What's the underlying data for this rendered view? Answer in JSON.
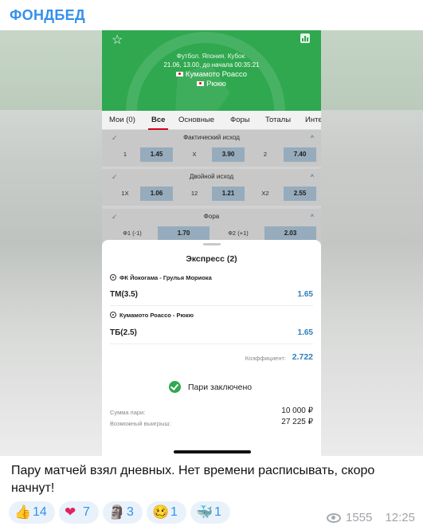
{
  "post": {
    "channel_name": "ФОНДБЕД",
    "caption": "Пару матчей взял дневных. Нет времени расписывать, скоро начнут!",
    "views": "1555",
    "time": "12:25"
  },
  "match": {
    "league": "Футбол. Япония. Кубок.",
    "datetime": "21.06, 13.00,  до начала 00:35:21",
    "team1": "Кумамото Роассо",
    "team2": "Рюкю",
    "icons": [
      "star-icon",
      "stats-icon",
      "flag-japan-icon"
    ],
    "header_color": "#2fa84f"
  },
  "tabs": [
    "Мои (0)",
    "Все",
    "Основные",
    "Форы",
    "Тоталы",
    "Инте"
  ],
  "active_tab": "Все",
  "markets": [
    {
      "title": "Фактический исход",
      "odds": [
        {
          "label": "1",
          "value": "1.45"
        },
        {
          "label": "X",
          "value": "3.90"
        },
        {
          "label": "2",
          "value": "7.40"
        }
      ]
    },
    {
      "title": "Двойной исход",
      "odds": [
        {
          "label": "1X",
          "value": "1.06"
        },
        {
          "label": "12",
          "value": "1.21"
        },
        {
          "label": "X2",
          "value": "2.55"
        }
      ]
    },
    {
      "title": "Фора",
      "odds": [
        {
          "label": "Ф1 (-1)",
          "value": "1.70"
        },
        {
          "label": "Ф2 (+1)",
          "value": "2.03"
        }
      ]
    }
  ],
  "express": {
    "title": "Экспресс (2)",
    "bets": [
      {
        "event": "ФК Йокогама - Грулья Мориока",
        "type": "ТМ(3.5)",
        "odd": "1.65"
      },
      {
        "event": "Кумамото Роассо - Рюкю",
        "type": "ТБ(2.5)",
        "odd": "1.65"
      }
    ],
    "coefficient_label": "Коэффициент:",
    "coefficient_value": "2.722",
    "status": "Пари заключено",
    "sum_label": "Сумма пари:",
    "sum_value": "10 000 ₽",
    "win_label": "Возможный выигрыш:",
    "win_value": "27 225 ₽",
    "accent_color": "#2a7fc0"
  },
  "reactions": [
    {
      "emoji": "👍",
      "name": "thumbs-up-icon",
      "count": "14"
    },
    {
      "emoji": "❤",
      "name": "heart-icon",
      "count": "7"
    },
    {
      "emoji": "🗿",
      "name": "moai-icon",
      "count": "3"
    },
    {
      "emoji": "🥴",
      "name": "woozy-face-icon",
      "count": "1"
    },
    {
      "emoji": "🐳",
      "name": "whale-icon",
      "count": "1"
    }
  ]
}
